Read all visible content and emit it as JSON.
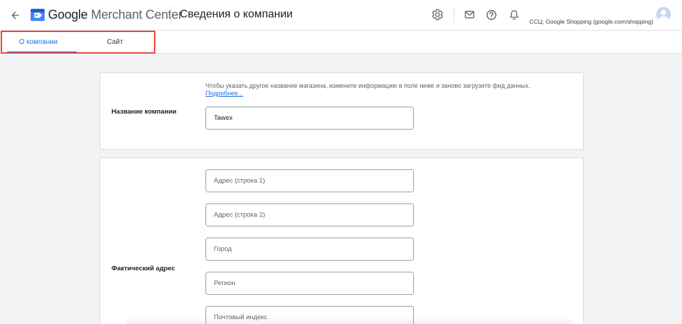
{
  "header": {
    "product_name_g": "Google",
    "product_name_rest": " Merchant Center",
    "page_title": "Сведения о компании",
    "account_label": "ССЦ: Google Shopping (google.com/shopping)",
    "icons": [
      "arrow-back-icon",
      "merchant-center-logo-icon",
      "settings-icon",
      "mail-icon",
      "help-icon",
      "notifications-icon",
      "avatar"
    ]
  },
  "tabs": [
    {
      "label": "О компании",
      "active": true
    },
    {
      "label": "Сайт",
      "active": false
    }
  ],
  "company_card": {
    "hint": "Чтобы указать другое название магазина, измените информацию в поле ниже и заново загрузите фид данных.",
    "hint_link": "Подробнее...",
    "label": "Название компании",
    "value": "Tawex"
  },
  "address_card": {
    "label": "Фактический адрес",
    "fields": [
      {
        "placeholder": "Адрес (строка 1)",
        "value": ""
      },
      {
        "placeholder": "Адрес (строка 2)",
        "value": ""
      },
      {
        "placeholder": "Город",
        "value": ""
      },
      {
        "placeholder": "Регион",
        "value": ""
      },
      {
        "placeholder": "Почтовый индекс",
        "value": ""
      }
    ]
  },
  "colors": {
    "accent": "#1a73e8",
    "highlight": "#e8473a",
    "page_background": "#f1f3f4"
  }
}
